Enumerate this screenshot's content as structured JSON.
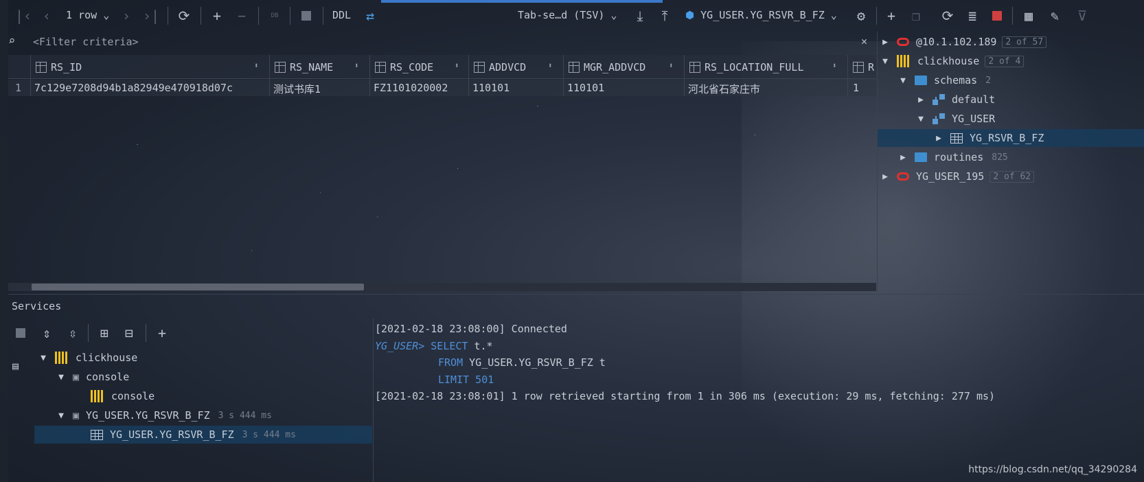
{
  "toolbar": {
    "rows_label": "1 row",
    "ddl_label": "DDL",
    "export_format": "Tab-se…d (TSV)",
    "table_selector": "YG_USER.YG_RSVR_B_FZ",
    "db_badge": "DB"
  },
  "filter": {
    "placeholder": "<Filter criteria>"
  },
  "grid": {
    "columns": [
      "RS_ID",
      "RS_NAME",
      "RS_CODE",
      "ADDVCD",
      "MGR_ADDVCD",
      "RS_LOCATION_FULL",
      "R"
    ],
    "rows": [
      {
        "num": "1",
        "cells": [
          "7c129e7208d94b1a82949e470918d07c",
          "测试书库1",
          "FZ1101020002",
          "110101",
          "110101",
          "河北省石家庄市",
          "1"
        ]
      }
    ]
  },
  "db_tree": {
    "items": [
      {
        "label": "@10.1.102.189",
        "badge": "2 of 57"
      },
      {
        "label": "clickhouse",
        "badge": "2 of 4"
      },
      {
        "label": "schemas",
        "count": "2"
      },
      {
        "label": "default"
      },
      {
        "label": "YG_USER"
      },
      {
        "label": "YG_RSVR_B_FZ"
      },
      {
        "label": "routines",
        "count": "825"
      },
      {
        "label": "YG_USER_195",
        "badge": "2 of 62"
      }
    ]
  },
  "services": {
    "title": "Services",
    "tree": [
      {
        "label": "clickhouse"
      },
      {
        "label": "console"
      },
      {
        "label": "console"
      },
      {
        "label": "YG_USER.YG_RSVR_B_FZ",
        "time": "3 s 444 ms"
      },
      {
        "label": "YG_USER.YG_RSVR_B_FZ",
        "time": "3 s 444 ms"
      }
    ]
  },
  "console": {
    "line1": "[2021-02-18 23:08:00] Connected",
    "prompt": "YG_USER>",
    "select_kw": "SELECT",
    "select_rest": " t.*",
    "from_kw": "FROM",
    "from_rest": " YG_USER.YG_RSVR_B_FZ t",
    "limit_kw": "LIMIT",
    "limit_val": " 501",
    "line5": "[2021-02-18 23:08:01] 1 row retrieved starting from 1 in 306 ms (execution: 29 ms, fetching: 277 ms)"
  },
  "watermark": "https://blog.csdn.net/qq_34290284"
}
